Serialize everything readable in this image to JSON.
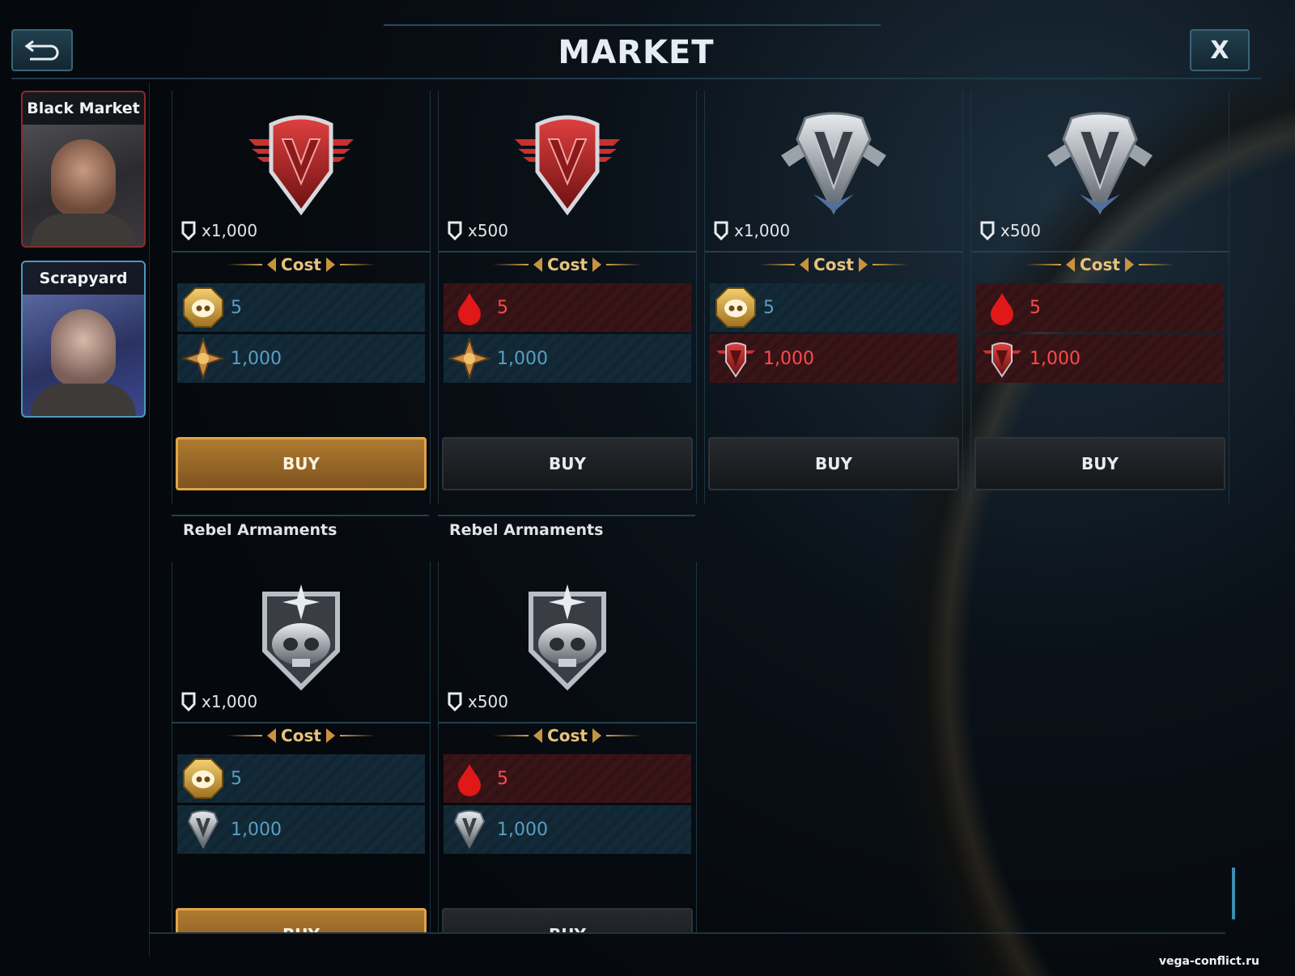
{
  "header": {
    "title": "MARKET",
    "back_label": "⮌",
    "close_label": "X"
  },
  "sidebar": {
    "vendors": [
      {
        "name": "Black Market"
      },
      {
        "name": "Scrapyard"
      }
    ]
  },
  "cost_label": "Cost",
  "buy_label": "BUY",
  "items": [
    {
      "emblem": "red-v-emblem-icon",
      "quantity": "x1,000",
      "prices": [
        {
          "icon": "skull-coin-icon",
          "value": "5",
          "tone": "blue"
        },
        {
          "icon": "star-badge-icon",
          "value": "1,000",
          "tone": "blue"
        }
      ],
      "selected": true
    },
    {
      "emblem": "red-v-emblem-icon",
      "quantity": "x500",
      "prices": [
        {
          "icon": "blood-drop-icon",
          "value": "5",
          "tone": "red"
        },
        {
          "icon": "star-badge-icon",
          "value": "1,000",
          "tone": "blue"
        }
      ],
      "selected": false
    },
    {
      "emblem": "silver-v-emblem-icon",
      "quantity": "x1,000",
      "prices": [
        {
          "icon": "skull-coin-icon",
          "value": "5",
          "tone": "blue"
        },
        {
          "icon": "red-v-token-icon",
          "value": "1,000",
          "tone": "red"
        }
      ],
      "selected": false
    },
    {
      "emblem": "silver-v-emblem-icon",
      "quantity": "x500",
      "prices": [
        {
          "icon": "blood-drop-icon",
          "value": "5",
          "tone": "red"
        },
        {
          "icon": "red-v-token-icon",
          "value": "1,000",
          "tone": "red"
        }
      ],
      "selected": false
    }
  ],
  "section_label": "Rebel Armaments",
  "items_row2": [
    {
      "emblem": "skull-shield-emblem-icon",
      "quantity": "x1,000",
      "prices": [
        {
          "icon": "skull-coin-icon",
          "value": "5",
          "tone": "blue"
        },
        {
          "icon": "silver-v-token-icon",
          "value": "1,000",
          "tone": "blue"
        }
      ],
      "selected": true
    },
    {
      "emblem": "skull-shield-emblem-icon",
      "quantity": "x500",
      "prices": [
        {
          "icon": "blood-drop-icon",
          "value": "5",
          "tone": "red"
        },
        {
          "icon": "silver-v-token-icon",
          "value": "1,000",
          "tone": "blue"
        }
      ],
      "selected": false
    }
  ],
  "colors": {
    "accent_gold": "#e0a448",
    "price_blue": "#5a9ec4",
    "price_red": "#ff4a4a",
    "frame": "#22404f"
  },
  "watermark": "vega-conflict.ru"
}
